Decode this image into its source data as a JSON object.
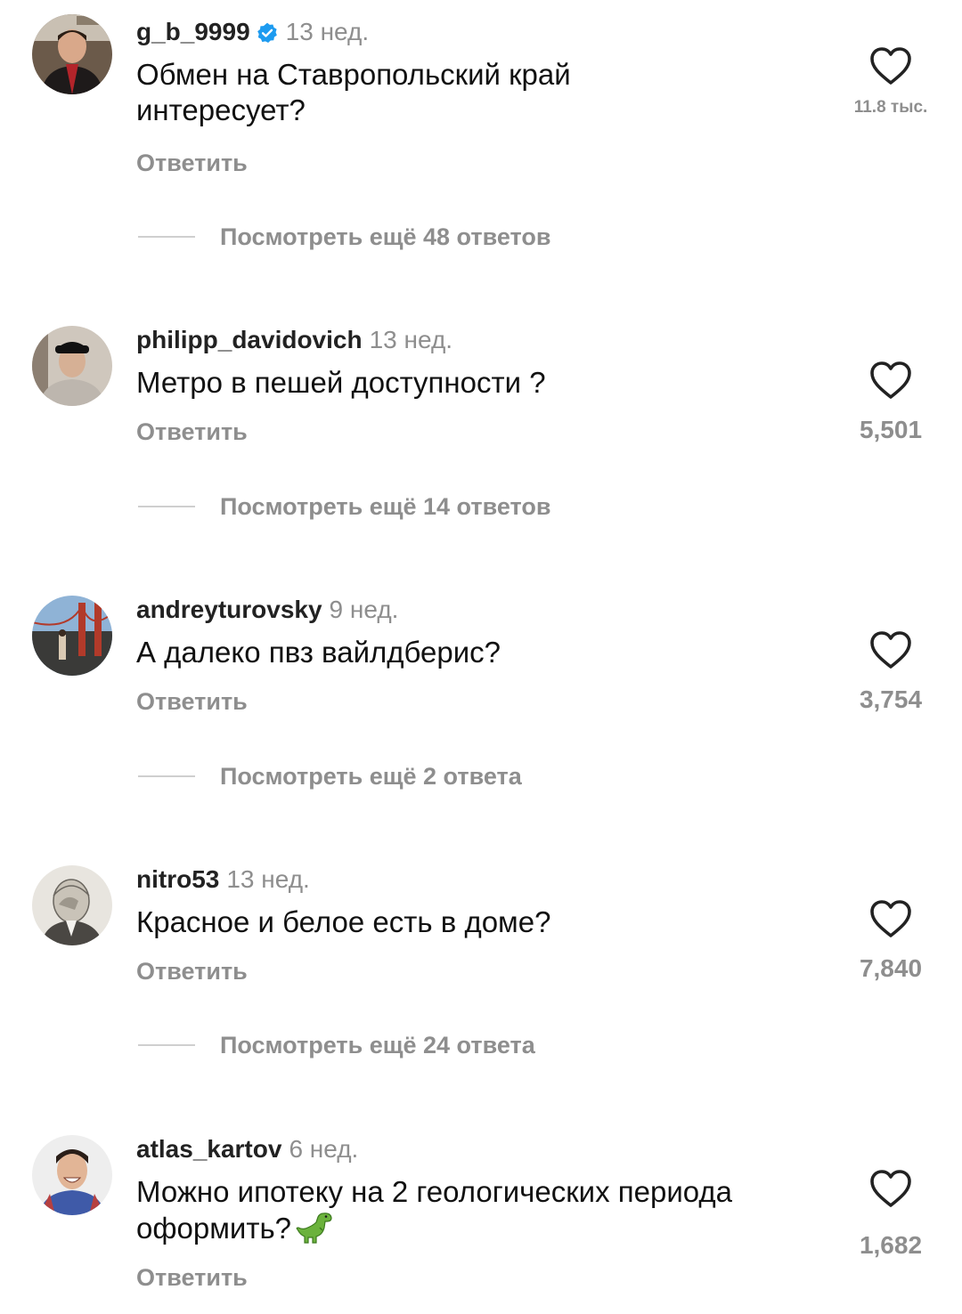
{
  "colors": {
    "text": "#111111",
    "muted": "#8e8e8e",
    "verified": "#1d9bf0"
  },
  "comments": [
    {
      "username": "g_b_9999",
      "verified": true,
      "time": "13 нед.",
      "text": "Обмен на Ставропольский край интересует?",
      "reply_label": "Ответить",
      "likes": "11.8 тыс.",
      "view_more": "Посмотреть ещё 48 ответов"
    },
    {
      "username": "philipp_davidovich",
      "verified": false,
      "time": "13 нед.",
      "text": "Метро в пешей доступности ?",
      "reply_label": "Ответить",
      "likes": "5,501",
      "view_more": "Посмотреть ещё 14 ответов"
    },
    {
      "username": "andreyturovsky",
      "verified": false,
      "time": "9 нед.",
      "text": "А далеко пвз вайлдберис?",
      "reply_label": "Ответить",
      "likes": "3,754",
      "view_more": "Посмотреть ещё 2 ответа"
    },
    {
      "username": "nitro53",
      "verified": false,
      "time": "13 нед.",
      "text": "Красное и белое есть в доме?",
      "reply_label": "Ответить",
      "likes": "7,840",
      "view_more": "Посмотреть ещё 24 ответа"
    },
    {
      "username": "atlas_kartov",
      "verified": false,
      "time": "6 нед.",
      "text": "Можно ипотеку на 2 геологических периода оформить?",
      "text_emoji": "dinosaur-emoji",
      "reply_label": "Ответить",
      "likes": "1,682"
    }
  ],
  "icons": {
    "like": "heart-outline-icon",
    "verified": "verified-badge-icon"
  }
}
